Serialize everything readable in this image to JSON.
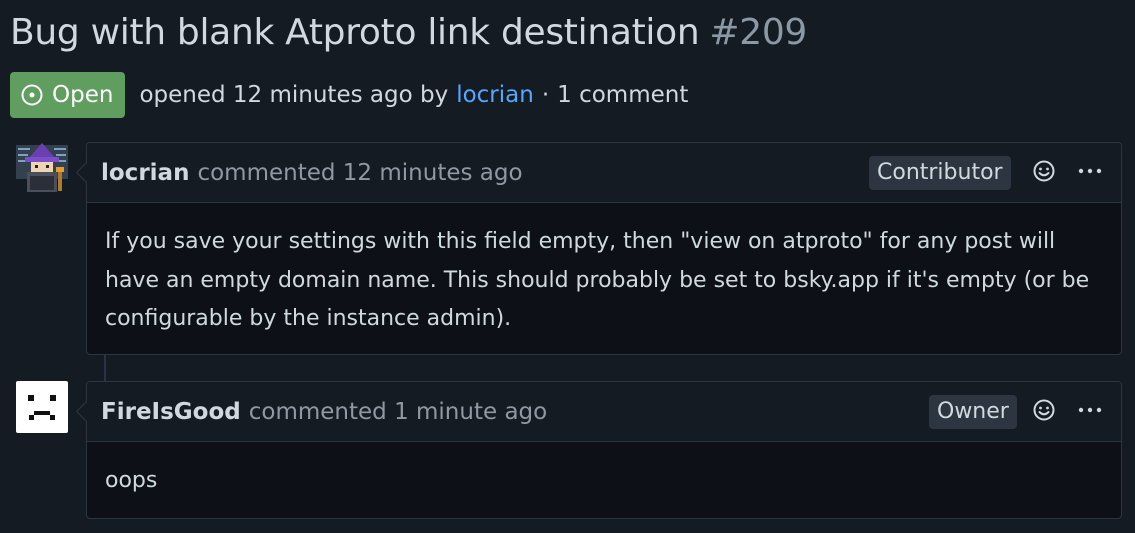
{
  "issue": {
    "title": "Bug with blank Atproto link destination",
    "number": "#209",
    "state_label": "Open",
    "state_icon": "issue-open-icon",
    "opened_text": "opened 12 minutes ago by",
    "author": "locrian",
    "separator": "·",
    "comment_count": "1 comment",
    "colors": {
      "state_green": "#5f9e5f",
      "link_blue": "#58a6ff"
    }
  },
  "comments": [
    {
      "author": "locrian",
      "time": "commented 12 minutes ago",
      "role": "Contributor",
      "body": "If you save your settings with this field empty, then \"view on atproto\" for any post will have an empty domain name. This should probably be set to bsky.app if it's empty (or be configurable by the instance admin).",
      "avatar_icon": "wizard-avatar-icon"
    },
    {
      "author": "FireIsGood",
      "time": "commented 1 minute ago",
      "role": "Owner",
      "body": "oops",
      "avatar_icon": "sad-face-avatar-icon"
    }
  ]
}
